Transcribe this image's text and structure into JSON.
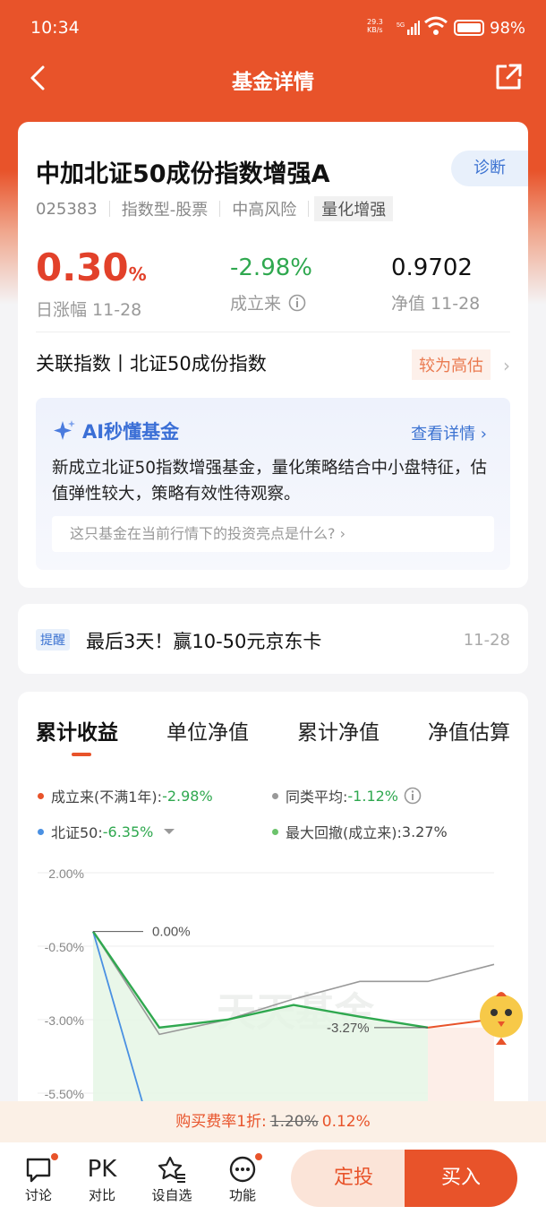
{
  "status_bar": {
    "time": "10:34",
    "net_speed_value": "29.3",
    "net_speed_unit": "KB/s",
    "net_type": "5G",
    "battery": "98%"
  },
  "nav": {
    "title": "基金详情"
  },
  "fund": {
    "name": "中加北证50成份指数增强A",
    "diagnose_label": "诊断",
    "code": "025383",
    "type": "指数型-股票",
    "risk": "中高风险",
    "strategy_tag": "量化增强",
    "daily_change": "0.30",
    "daily_change_unit": "%",
    "daily_change_label": "日涨幅 11-28",
    "since_inception": "-2.98%",
    "since_inception_label": "成立来",
    "nav": "0.9702",
    "nav_label": "净值 11-28",
    "index_label": "关联指数丨北证50成份指数",
    "valuation": "较为高估"
  },
  "ai": {
    "title": "AI秒懂基金",
    "more": "查看详情",
    "text": "新成立北证50指数增强基金，量化策略结合中小盘特征，估值弹性较大，策略有效性待观察。",
    "question": "这只基金在当前行情下的投资亮点是什么?"
  },
  "notice": {
    "badge": "提醒",
    "text": "最后3天！赢10-50元京东卡",
    "date": "11-28"
  },
  "tabs": [
    "累计收益",
    "单位净值",
    "累计净值",
    "净值估算"
  ],
  "legend": {
    "fund": {
      "label": "成立来(不满1年):",
      "value": "-2.98%",
      "color": "#e8532a"
    },
    "peer": {
      "label": "同类平均:",
      "value": "-1.12%",
      "color": "#999999"
    },
    "index": {
      "label": "北证50:",
      "value": "-6.35%",
      "color": "#4a90e2"
    },
    "drawdown": {
      "label": "最大回撤(成立来):",
      "value": "3.27%",
      "color": "#6cc36c"
    }
  },
  "chart_data": {
    "type": "line",
    "ytick_labels": [
      "2.00%",
      "-0.50%",
      "-3.00%",
      "-5.50%"
    ],
    "yticks": [
      2.0,
      -0.5,
      -3.0,
      -5.5
    ],
    "ylim": [
      -5.5,
      2.0
    ],
    "annotations": [
      "0.00%",
      "-3.27%"
    ],
    "watermark": "天天基金",
    "series": [
      {
        "name": "成立来",
        "color": "#2fa84f",
        "values": [
          0.0,
          -3.27,
          -3.0,
          -2.5,
          -2.9,
          -3.27
        ]
      },
      {
        "name": "同类平均",
        "color": "#999999",
        "values": [
          0.0,
          -3.5,
          -3.0,
          -2.3,
          -1.7,
          -1.7,
          -1.12
        ]
      },
      {
        "name": "北证50",
        "color": "#4a90e2",
        "values": [
          0.0,
          -6.35
        ]
      }
    ]
  },
  "fee": {
    "prefix": "购买费率1折:",
    "original": "1.20%",
    "discounted": "0.12%"
  },
  "bottom": {
    "discuss": "讨论",
    "pk_icon": "PK",
    "compare": "对比",
    "watchlist": "设自选",
    "functions": "功能",
    "plan": "定投",
    "buy": "买入"
  }
}
